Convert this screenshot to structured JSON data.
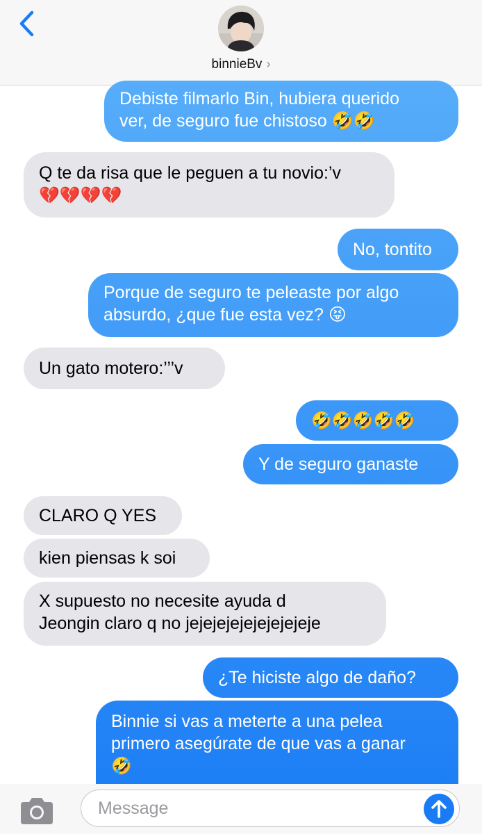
{
  "header": {
    "contact_name": "binnieBv",
    "chevron": "›"
  },
  "colors": {
    "outgoing_top": "#5db2fa",
    "outgoing_bottom": "#1a7cf5",
    "incoming": "#e5e5ea",
    "accent": "#1a7cf5"
  },
  "icons": {
    "back": "chevron-left-icon",
    "camera": "camera-icon",
    "send": "arrow-up-icon"
  },
  "messages": [
    {
      "dir": "out",
      "lines": [
        "Debiste filmarlo Bin, hubiera querido",
        "ver, de seguro fue chistoso 🤣🤣"
      ]
    },
    {
      "dir": "in",
      "lines": [
        "Q te da risa que le peguen a tu novio:’v",
        "💔💔💔💔"
      ]
    },
    {
      "dir": "out",
      "lines": [
        "No, tontito"
      ]
    },
    {
      "dir": "out",
      "lines": [
        "Porque de seguro te peleaste por algo",
        "absurdo, ¿que fue esta vez? 😝"
      ]
    },
    {
      "dir": "in",
      "lines": [
        "Un gato motero:’’’v"
      ]
    },
    {
      "dir": "out",
      "lines": [
        "🤣🤣🤣🤣🤣"
      ]
    },
    {
      "dir": "out",
      "lines": [
        "Y de seguro ganaste"
      ]
    },
    {
      "dir": "in",
      "lines": [
        "CLARO Q YES"
      ]
    },
    {
      "dir": "in",
      "lines": [
        "kien piensas k soi"
      ]
    },
    {
      "dir": "in",
      "lines": [
        "X supuesto no necesite ayuda d",
        "Jeongin claro q no jejejejejejejejejeje"
      ]
    },
    {
      "dir": "out",
      "lines": [
        "¿Te hiciste algo de daño?"
      ]
    },
    {
      "dir": "out",
      "lines": [
        "Binnie si vas a meterte a una pelea",
        "primero asegúrate de que vas a ganar",
        "🤣"
      ]
    }
  ],
  "composer": {
    "placeholder": "Message",
    "value": ""
  }
}
